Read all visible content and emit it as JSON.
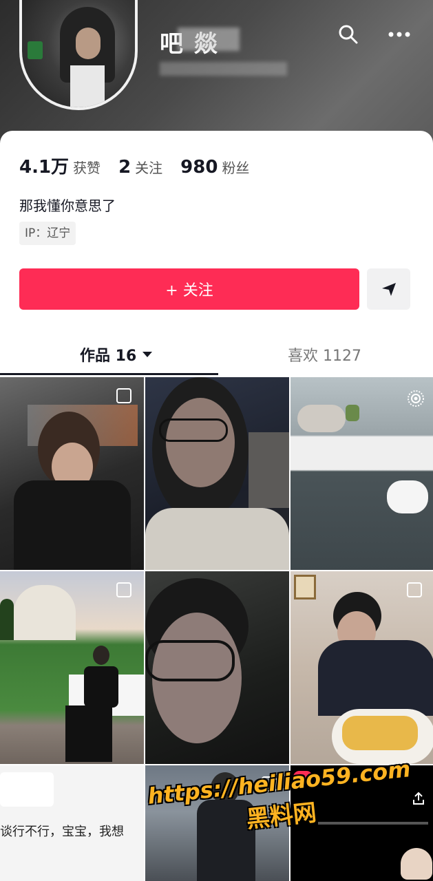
{
  "profile": {
    "name": "吧 燚",
    "stats": [
      {
        "value": "4.1万",
        "label": "获赞"
      },
      {
        "value": "2",
        "label": "关注"
      },
      {
        "value": "980",
        "label": "粉丝"
      }
    ],
    "bio": "那我懂你意思了",
    "ip": "IP：辽宁"
  },
  "actions": {
    "follow_label": "+ 关注",
    "search_icon": "search-icon",
    "more_icon": "more-icon",
    "share_icon": "send-icon"
  },
  "tabs": [
    {
      "label": "作品 16",
      "active": true
    },
    {
      "label": "喜欢 1127",
      "active": false
    }
  ],
  "grid": {
    "last_row_text": "谈行不行，宝宝，我想"
  },
  "watermark": {
    "url": "https://heiliao59.com",
    "text": "黑料网"
  },
  "colors": {
    "follow_button": "#fe2c55",
    "watermark": "#ffb321"
  }
}
